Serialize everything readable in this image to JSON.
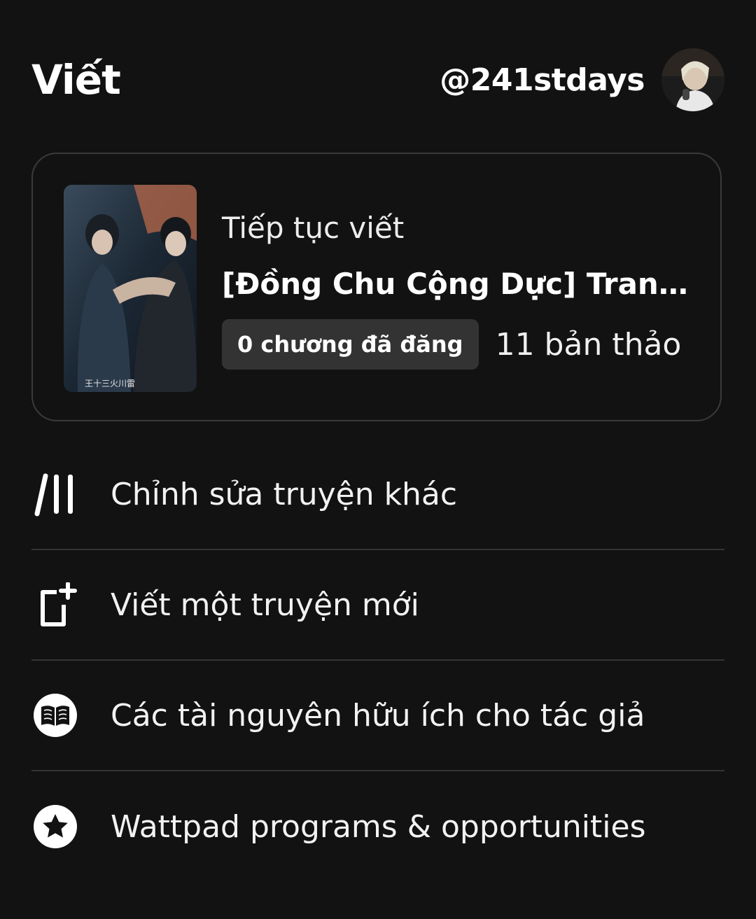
{
  "header": {
    "title": "Viết",
    "username": "@241stdays",
    "avatar_icon": "user-avatar"
  },
  "story_card": {
    "continue_label": "Tiếp tục viết",
    "title": "[Đồng Chu Cộng Dực] Trans -...",
    "published_badge": "0 chương đã đăng",
    "drafts": "11 bản thảo",
    "cover_icon": "story-cover-image"
  },
  "menu": {
    "items": [
      {
        "label": "Chỉnh sửa truyện khác",
        "icon": "library-edit-icon"
      },
      {
        "label": "Viết một truyện mới",
        "icon": "new-story-icon"
      },
      {
        "label": "Các tài nguyên hữu ích cho tác giả",
        "icon": "book-icon"
      },
      {
        "label": "Wattpad programs & opportunities",
        "icon": "star-icon"
      }
    ]
  },
  "colors": {
    "background": "#121212",
    "card_border": "#3a3a3a",
    "badge_bg": "#333333",
    "divider": "#333333",
    "text": "#f2f2f2"
  }
}
